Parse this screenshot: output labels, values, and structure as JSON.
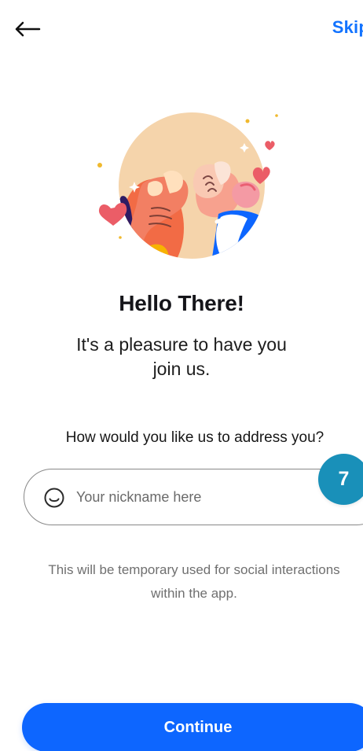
{
  "navigation": {
    "skip_label": "Skip"
  },
  "intro": {
    "title": "Hello There!",
    "subtitle_line1": "It's a pleasure to have you",
    "subtitle_line2": "join us."
  },
  "nickname_form": {
    "question": "How would you like us to address you?",
    "placeholder": "Your nickname here",
    "step_number": "7",
    "helper_line1": "This will be temporary used for social interactions",
    "helper_line2": "within the app."
  },
  "actions": {
    "continue_label": "Continue"
  },
  "icons": {
    "back": "back-arrow-icon",
    "input": "smile-icon",
    "illustration": "fist-bump-illustration"
  },
  "colors": {
    "accent": "#0d66ff",
    "link": "#1273ff",
    "badge": "#1990b9",
    "text": "#15151a",
    "muted": "#6f6f6f"
  }
}
